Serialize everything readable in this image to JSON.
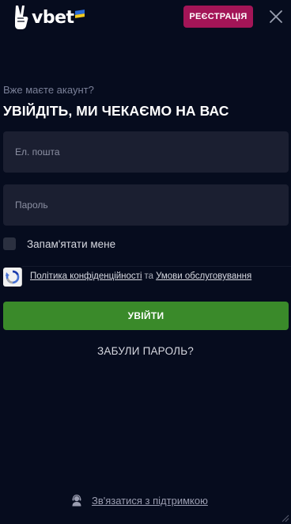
{
  "header": {
    "logo_text": "vbet",
    "register_label": "РЕЄСТРАЦІЯ"
  },
  "form": {
    "subtitle": "Вже маєте акаунт?",
    "title": "УВІЙДІТЬ, МИ ЧЕКАЄМО НА ВАС",
    "email_placeholder": "Ел. пошта",
    "email_value": "",
    "password_placeholder": "Пароль",
    "password_value": "",
    "remember_label": "Запам'ятати мене",
    "remember_checked": false,
    "privacy_link": "Політика конфіденційності",
    "and_text": "та",
    "terms_link": "Умови обслуговування",
    "login_label": "УВІЙТИ",
    "forgot_label": "ЗАБУЛИ ПАРОЛЬ?"
  },
  "footer": {
    "support_label": "Зв'язатися з підтримкою"
  },
  "colors": {
    "background": "#060c1e",
    "register_button": "#a31557",
    "login_button": "#3a8a2a",
    "field_background": "#1b1f31"
  },
  "icons": {
    "logo": "victory-hand-icon",
    "flag": "ukraine-flag-icon",
    "close": "close-icon",
    "recaptcha": "recaptcha-icon",
    "support": "support-agent-icon"
  }
}
